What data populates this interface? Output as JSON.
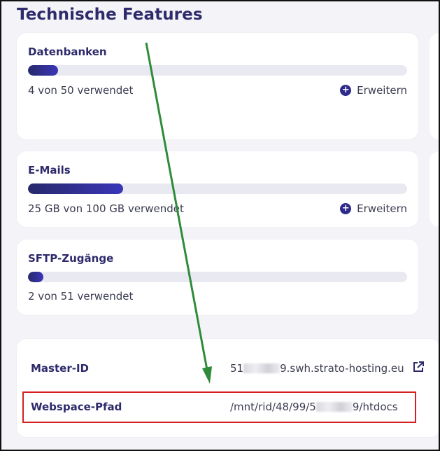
{
  "page": {
    "title": "Technische Features"
  },
  "features": [
    {
      "title": "Datenbanken",
      "usage": "4 von 50 verwendet",
      "fraction": 0.08,
      "expand_label": "Erweitern",
      "has_expand": true
    },
    {
      "title": "E-Mails",
      "usage": "25 GB von 100 GB verwendet",
      "fraction": 0.25,
      "expand_label": "Erweitern",
      "has_expand": true
    },
    {
      "title": "SFTP-Zugänge",
      "usage": "2 von 51 verwendet",
      "fraction": 0.04,
      "has_expand": false
    }
  ],
  "info": {
    "master_id": {
      "label": "Master-ID",
      "value_prefix": "51",
      "value_suffix": "9.swh.strato-hosting.eu",
      "icon": "external-link-icon"
    },
    "webspace": {
      "label": "Webspace-Pfad",
      "value_prefix": "/mnt/rid/48/99/5",
      "value_suffix": "9/htdocs"
    }
  },
  "colors": {
    "accent": "#2e2a6b",
    "bar_fill": "#3a36b8",
    "highlight": "#d42222",
    "arrow": "#2e8b3a"
  }
}
